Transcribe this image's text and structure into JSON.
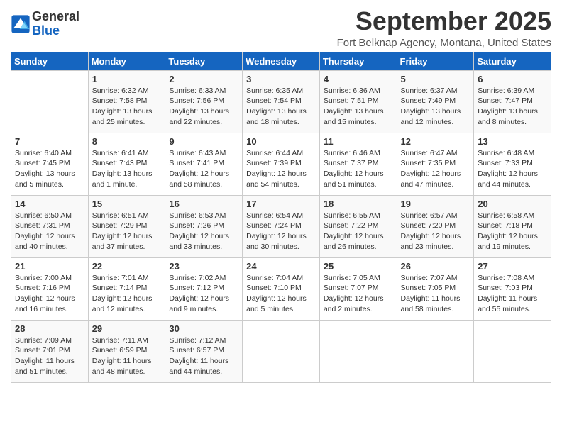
{
  "header": {
    "logo_line1": "General",
    "logo_line2": "Blue",
    "month": "September 2025",
    "location": "Fort Belknap Agency, Montana, United States"
  },
  "weekdays": [
    "Sunday",
    "Monday",
    "Tuesday",
    "Wednesday",
    "Thursday",
    "Friday",
    "Saturday"
  ],
  "weeks": [
    [
      {
        "day": "",
        "info": ""
      },
      {
        "day": "1",
        "info": "Sunrise: 6:32 AM\nSunset: 7:58 PM\nDaylight: 13 hours and 25 minutes."
      },
      {
        "day": "2",
        "info": "Sunrise: 6:33 AM\nSunset: 7:56 PM\nDaylight: 13 hours and 22 minutes."
      },
      {
        "day": "3",
        "info": "Sunrise: 6:35 AM\nSunset: 7:54 PM\nDaylight: 13 hours and 18 minutes."
      },
      {
        "day": "4",
        "info": "Sunrise: 6:36 AM\nSunset: 7:51 PM\nDaylight: 13 hours and 15 minutes."
      },
      {
        "day": "5",
        "info": "Sunrise: 6:37 AM\nSunset: 7:49 PM\nDaylight: 13 hours and 12 minutes."
      },
      {
        "day": "6",
        "info": "Sunrise: 6:39 AM\nSunset: 7:47 PM\nDaylight: 13 hours and 8 minutes."
      }
    ],
    [
      {
        "day": "7",
        "info": "Sunrise: 6:40 AM\nSunset: 7:45 PM\nDaylight: 13 hours and 5 minutes."
      },
      {
        "day": "8",
        "info": "Sunrise: 6:41 AM\nSunset: 7:43 PM\nDaylight: 13 hours and 1 minute."
      },
      {
        "day": "9",
        "info": "Sunrise: 6:43 AM\nSunset: 7:41 PM\nDaylight: 12 hours and 58 minutes."
      },
      {
        "day": "10",
        "info": "Sunrise: 6:44 AM\nSunset: 7:39 PM\nDaylight: 12 hours and 54 minutes."
      },
      {
        "day": "11",
        "info": "Sunrise: 6:46 AM\nSunset: 7:37 PM\nDaylight: 12 hours and 51 minutes."
      },
      {
        "day": "12",
        "info": "Sunrise: 6:47 AM\nSunset: 7:35 PM\nDaylight: 12 hours and 47 minutes."
      },
      {
        "day": "13",
        "info": "Sunrise: 6:48 AM\nSunset: 7:33 PM\nDaylight: 12 hours and 44 minutes."
      }
    ],
    [
      {
        "day": "14",
        "info": "Sunrise: 6:50 AM\nSunset: 7:31 PM\nDaylight: 12 hours and 40 minutes."
      },
      {
        "day": "15",
        "info": "Sunrise: 6:51 AM\nSunset: 7:29 PM\nDaylight: 12 hours and 37 minutes."
      },
      {
        "day": "16",
        "info": "Sunrise: 6:53 AM\nSunset: 7:26 PM\nDaylight: 12 hours and 33 minutes."
      },
      {
        "day": "17",
        "info": "Sunrise: 6:54 AM\nSunset: 7:24 PM\nDaylight: 12 hours and 30 minutes."
      },
      {
        "day": "18",
        "info": "Sunrise: 6:55 AM\nSunset: 7:22 PM\nDaylight: 12 hours and 26 minutes."
      },
      {
        "day": "19",
        "info": "Sunrise: 6:57 AM\nSunset: 7:20 PM\nDaylight: 12 hours and 23 minutes."
      },
      {
        "day": "20",
        "info": "Sunrise: 6:58 AM\nSunset: 7:18 PM\nDaylight: 12 hours and 19 minutes."
      }
    ],
    [
      {
        "day": "21",
        "info": "Sunrise: 7:00 AM\nSunset: 7:16 PM\nDaylight: 12 hours and 16 minutes."
      },
      {
        "day": "22",
        "info": "Sunrise: 7:01 AM\nSunset: 7:14 PM\nDaylight: 12 hours and 12 minutes."
      },
      {
        "day": "23",
        "info": "Sunrise: 7:02 AM\nSunset: 7:12 PM\nDaylight: 12 hours and 9 minutes."
      },
      {
        "day": "24",
        "info": "Sunrise: 7:04 AM\nSunset: 7:10 PM\nDaylight: 12 hours and 5 minutes."
      },
      {
        "day": "25",
        "info": "Sunrise: 7:05 AM\nSunset: 7:07 PM\nDaylight: 12 hours and 2 minutes."
      },
      {
        "day": "26",
        "info": "Sunrise: 7:07 AM\nSunset: 7:05 PM\nDaylight: 11 hours and 58 minutes."
      },
      {
        "day": "27",
        "info": "Sunrise: 7:08 AM\nSunset: 7:03 PM\nDaylight: 11 hours and 55 minutes."
      }
    ],
    [
      {
        "day": "28",
        "info": "Sunrise: 7:09 AM\nSunset: 7:01 PM\nDaylight: 11 hours and 51 minutes."
      },
      {
        "day": "29",
        "info": "Sunrise: 7:11 AM\nSunset: 6:59 PM\nDaylight: 11 hours and 48 minutes."
      },
      {
        "day": "30",
        "info": "Sunrise: 7:12 AM\nSunset: 6:57 PM\nDaylight: 11 hours and 44 minutes."
      },
      {
        "day": "",
        "info": ""
      },
      {
        "day": "",
        "info": ""
      },
      {
        "day": "",
        "info": ""
      },
      {
        "day": "",
        "info": ""
      }
    ]
  ]
}
